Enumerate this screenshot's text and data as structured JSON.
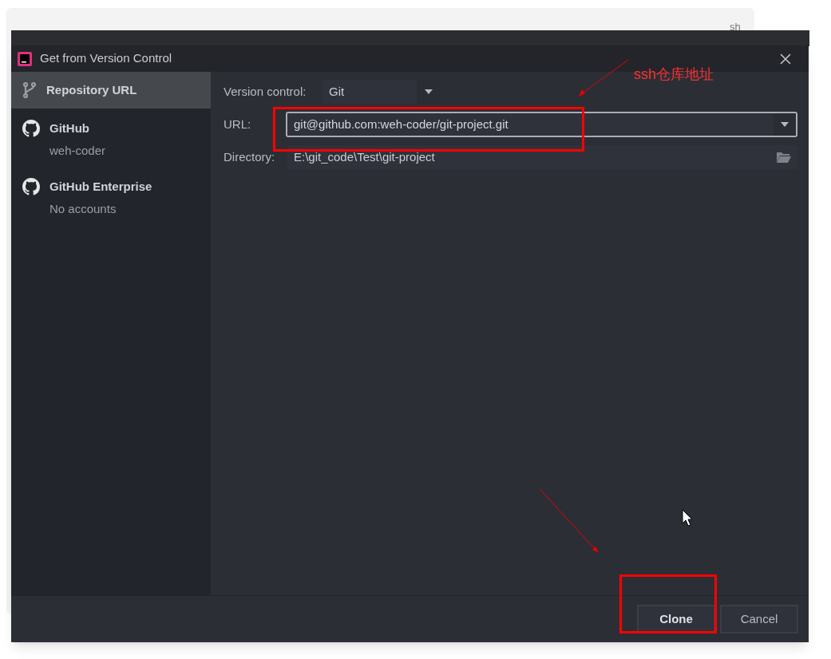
{
  "background": {
    "text": "sh"
  },
  "window": {
    "title": "Get from Version Control"
  },
  "sidebar": {
    "items": [
      {
        "kind": "repository",
        "title": "Repository URL",
        "selected": true
      },
      {
        "kind": "github",
        "title": "GitHub",
        "subtitle": "weh-coder",
        "selected": false
      },
      {
        "kind": "github",
        "title": "GitHub Enterprise",
        "subtitle": "No accounts",
        "selected": false
      }
    ]
  },
  "form": {
    "version_control": {
      "label": "Version control:",
      "value": "Git"
    },
    "url": {
      "label": "URL:",
      "value": "git@github.com:weh-coder/git-project.git"
    },
    "directory": {
      "label": "Directory:",
      "value": "E:\\git_code\\Test\\git-project"
    }
  },
  "buttons": [
    {
      "label": "Clone",
      "default": true
    },
    {
      "label": "Cancel",
      "default": false
    }
  ],
  "annotation": {
    "text": "ssh仓库地址"
  }
}
